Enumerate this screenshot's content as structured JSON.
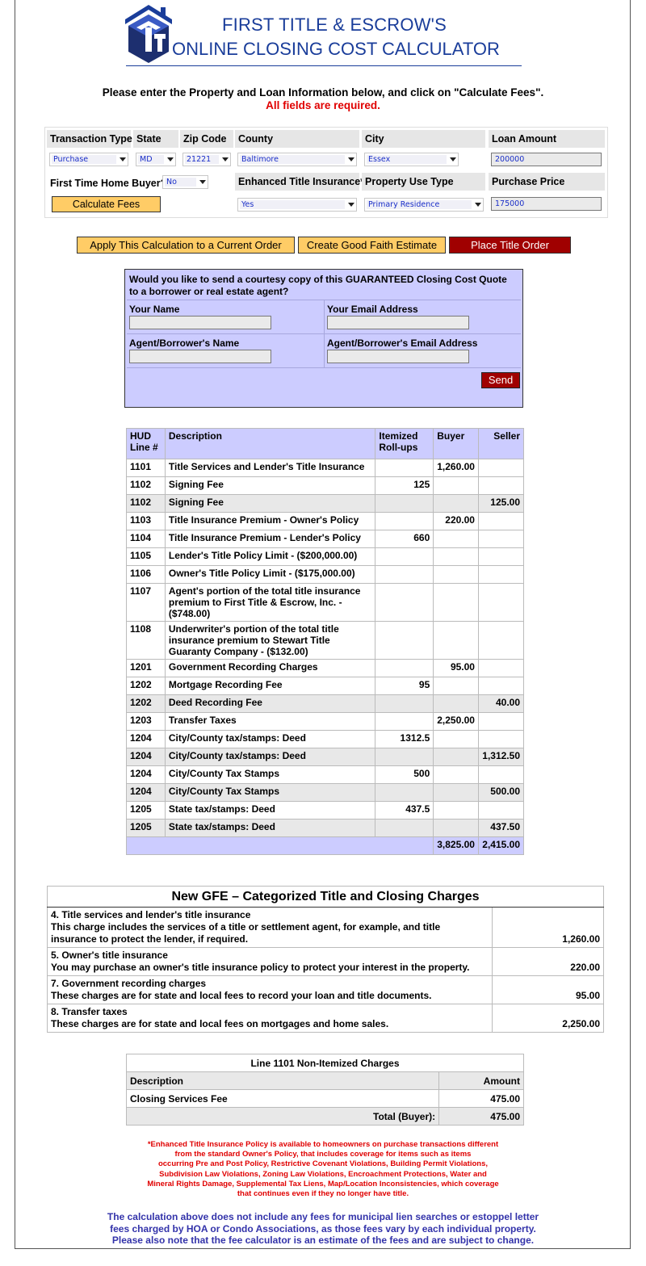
{
  "header": {
    "title_line1": "FIRST TITLE & ESCROW'S",
    "title_line2": "ONLINE CLOSING COST CALCULATOR",
    "instruction": "Please enter the Property and Loan Information below, and click on \"Calculate Fees\".",
    "required_note": "All fields are required."
  },
  "form": {
    "transaction_type": {
      "label": "Transaction Type",
      "value": "Purchase"
    },
    "state": {
      "label": "State",
      "value": "MD"
    },
    "zip_code": {
      "label": "Zip Code",
      "value": "21221"
    },
    "county": {
      "label": "County",
      "value": "Baltimore"
    },
    "city": {
      "label": "City",
      "value": "Essex"
    },
    "loan_amount": {
      "label": "Loan Amount",
      "value": "200000"
    },
    "first_time_buyer": {
      "label": "First Time Home Buyer?",
      "value": "No"
    },
    "enhanced_title": {
      "label": "Enhanced Title Insurance*",
      "value": "Yes"
    },
    "property_use": {
      "label": "Property Use Type",
      "value": "Primary Residence"
    },
    "purchase_price": {
      "label": "Purchase Price",
      "value": "175000"
    },
    "calculate_label": "Calculate Fees"
  },
  "actions": {
    "apply": "Apply This Calculation to a Current Order",
    "gfe": "Create Good Faith Estimate",
    "place_order": "Place Title Order"
  },
  "courtesy": {
    "question": "Would you like to send a courtesy copy of this GUARANTEED Closing Cost Quote to a borrower or real estate agent?",
    "your_name": "Your Name",
    "your_email": "Your Email Address",
    "agent_name": "Agent/Borrower's Name",
    "agent_email": "Agent/Borrower's Email Address",
    "send": "Send"
  },
  "fees": {
    "headers": [
      "HUD Line #",
      "Description",
      "Itemized Roll-ups",
      "Buyer",
      "Seller"
    ],
    "rows": [
      {
        "line": "1101",
        "desc": "Title Services and Lender's Title Insurance",
        "item": "",
        "buyer": "1,260.00",
        "seller": ""
      },
      {
        "line": "1102",
        "desc": "Signing Fee",
        "item": "125",
        "buyer": "",
        "seller": ""
      },
      {
        "line": "1102",
        "desc": "Signing Fee",
        "item": "",
        "buyer": "",
        "seller": "125.00"
      },
      {
        "line": "1103",
        "desc": "Title Insurance Premium - Owner's Policy",
        "item": "",
        "buyer": "220.00",
        "seller": ""
      },
      {
        "line": "1104",
        "desc": "Title Insurance Premium - Lender's Policy",
        "item": "660",
        "buyer": "",
        "seller": ""
      },
      {
        "line": "1105",
        "desc": "Lender's Title Policy Limit - ($200,000.00)",
        "item": "",
        "buyer": "",
        "seller": ""
      },
      {
        "line": "1106",
        "desc": "Owner's Title Policy Limit - ($175,000.00)",
        "item": "",
        "buyer": "",
        "seller": ""
      },
      {
        "line": "1107",
        "desc": "Agent's portion of the total title insurance premium to First Title & Escrow, Inc. - ($748.00)",
        "item": "",
        "buyer": "",
        "seller": ""
      },
      {
        "line": "1108",
        "desc": "Underwriter's portion of the total title insurance premium to Stewart Title Guaranty Company - ($132.00)",
        "item": "",
        "buyer": "",
        "seller": ""
      },
      {
        "line": "1201",
        "desc": "Government Recording Charges",
        "item": "",
        "buyer": "95.00",
        "seller": ""
      },
      {
        "line": "1202",
        "desc": "Mortgage Recording Fee",
        "item": "95",
        "buyer": "",
        "seller": ""
      },
      {
        "line": "1202",
        "desc": "Deed Recording Fee",
        "item": "",
        "buyer": "",
        "seller": "40.00"
      },
      {
        "line": "1203",
        "desc": "Transfer Taxes",
        "item": "",
        "buyer": "2,250.00",
        "seller": ""
      },
      {
        "line": "1204",
        "desc": "City/County tax/stamps: Deed",
        "item": "1312.5",
        "buyer": "",
        "seller": ""
      },
      {
        "line": "1204",
        "desc": "City/County tax/stamps: Deed",
        "item": "",
        "buyer": "",
        "seller": "1,312.50"
      },
      {
        "line": "1204",
        "desc": "City/County Tax Stamps",
        "item": "500",
        "buyer": "",
        "seller": ""
      },
      {
        "line": "1204",
        "desc": "City/County Tax Stamps",
        "item": "",
        "buyer": "",
        "seller": "500.00"
      },
      {
        "line": "1205",
        "desc": "State tax/stamps: Deed",
        "item": "437.5",
        "buyer": "",
        "seller": ""
      },
      {
        "line": "1205",
        "desc": "State tax/stamps: Deed",
        "item": "",
        "buyer": "",
        "seller": "437.50"
      }
    ],
    "total_buyer": "3,825.00",
    "total_seller": "2,415.00"
  },
  "gfe": {
    "title": "New GFE – Categorized Title and Closing Charges",
    "rows": [
      {
        "heading": "4. Title services and lender's title insurance",
        "text": "This charge includes the services of a title or settlement agent, for example, and title insurance to protect the lender, if required.",
        "amount": "1,260.00"
      },
      {
        "heading": "5. Owner's title insurance",
        "text": "You may purchase an owner's title insurance policy to protect your interest in the property.",
        "amount": "220.00"
      },
      {
        "heading": "7. Government recording charges",
        "text": "These charges are for state and local fees to record your loan and title documents.",
        "amount": "95.00"
      },
      {
        "heading": "8. Transfer taxes",
        "text": "These charges are for state and local fees on mortgages and home sales.",
        "amount": "2,250.00"
      }
    ]
  },
  "nonitemized": {
    "title": "Line 1101 Non-Itemized Charges",
    "desc_header": "Description",
    "amount_header": "Amount",
    "item_desc": "Closing Services Fee",
    "item_amount": "475.00",
    "total_label": "Total (Buyer):",
    "total_amount": "475.00"
  },
  "footnotes": {
    "enhanced": [
      "*Enhanced Title Insurance Policy is available to homeowners on purchase transactions different",
      "from the standard Owner's Policy, that includes coverage for items such as items",
      "occurring Pre and Post Policy, Restrictive Covenant Violations, Building Permit Violations,",
      "Subdivision Law Violations, Zoning Law Violations, Encroachment Protections, Water and",
      "Mineral Rights Damage, Supplemental Tax Liens, Map/Location Inconsistencies, which coverage",
      "that continues even if they no longer have title."
    ],
    "disclaimer": [
      "The calculation above does not include any fees for municipal lien searches or estoppel letter",
      "fees charged by HOA or Condo Associations, as those fees vary by each individual property.",
      "Please also note that the fee calculator is an estimate of the fees and are subject to change."
    ]
  },
  "colors": {
    "brand_blue": "#1a3d9a",
    "required_red": "#e00000",
    "panel_lavender": "#ccccff",
    "button_yellow": "#ffcc66",
    "button_red": "#a00000"
  }
}
